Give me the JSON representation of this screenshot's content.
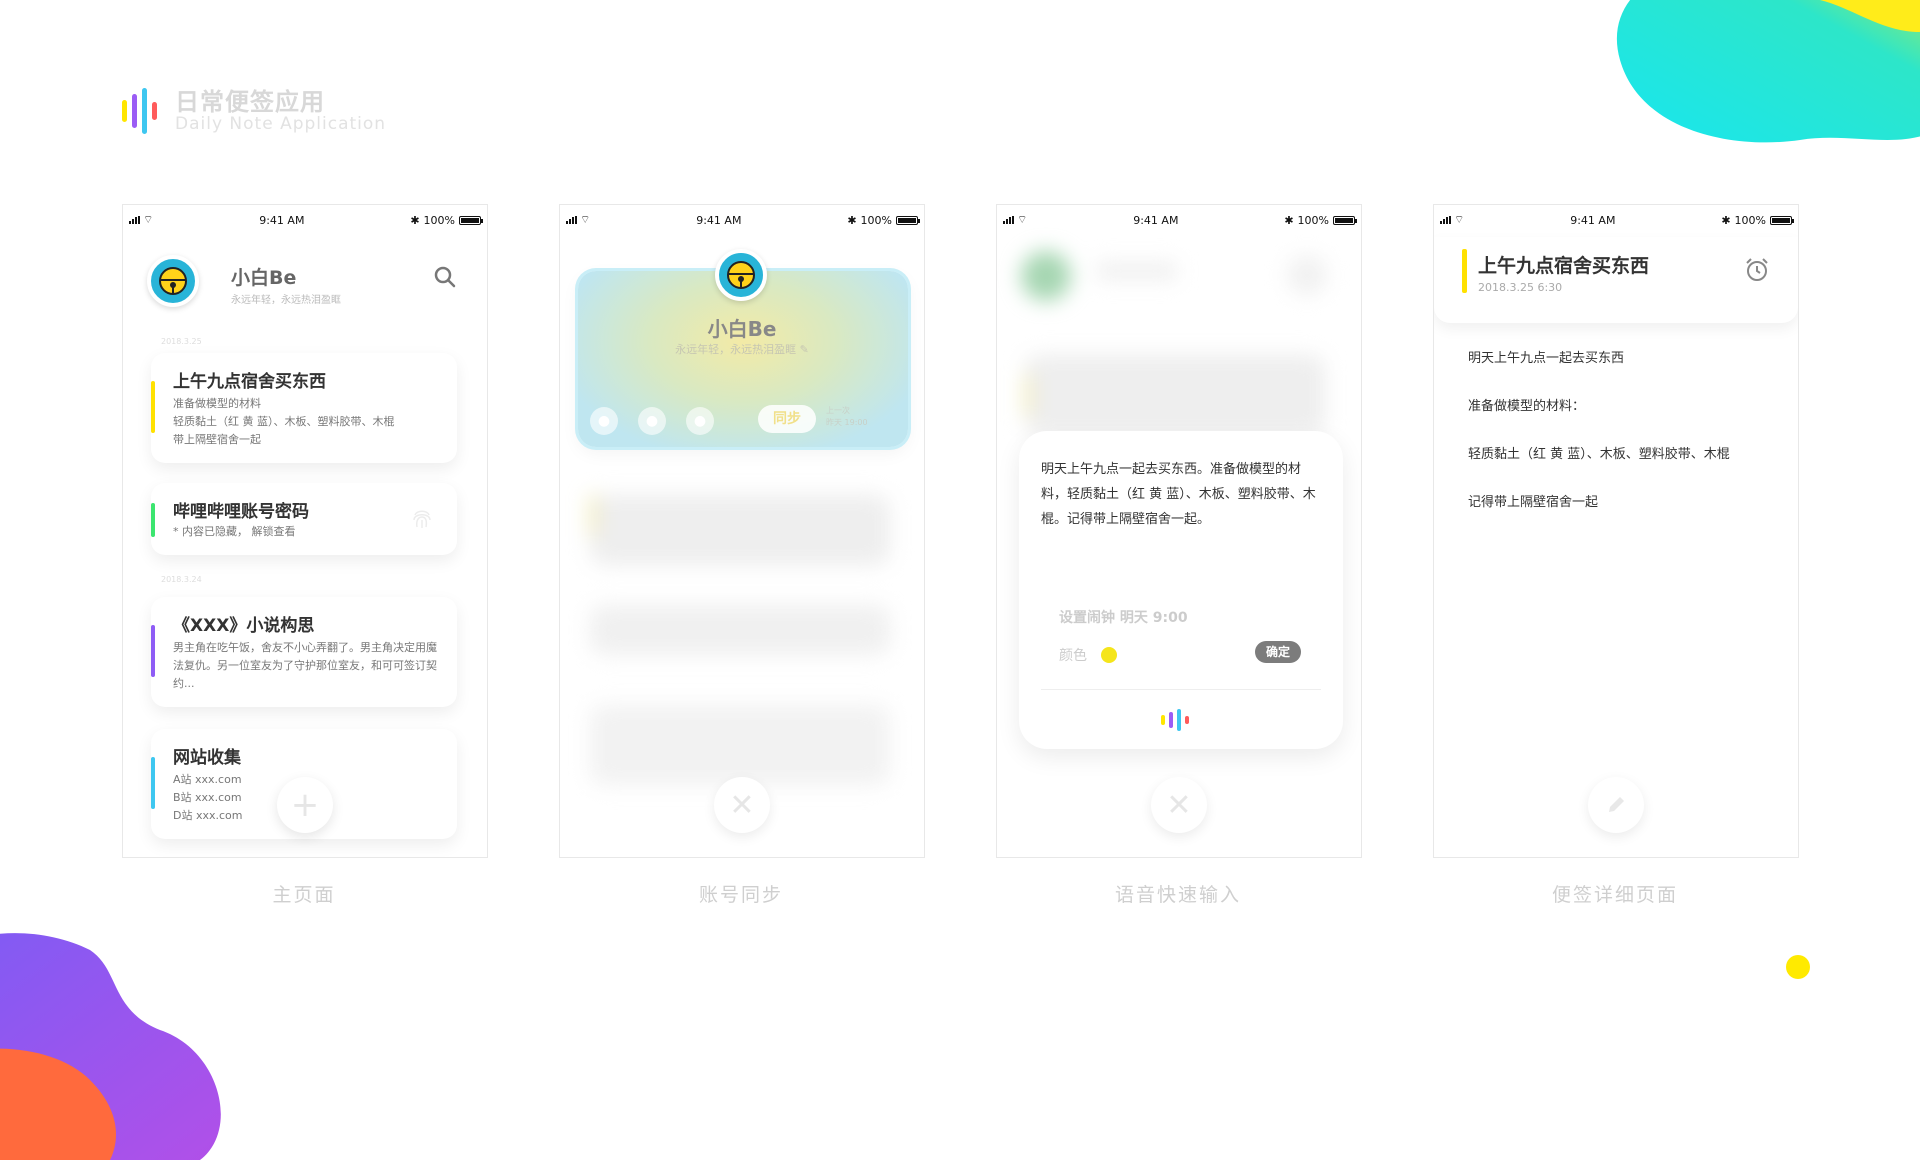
{
  "brand": {
    "title": "日常便签应用",
    "subtitle": "Daily Note Application",
    "bar_colors": [
      "#ffe600",
      "#9b5cf5",
      "#3ec7f0",
      "#ff5b5b"
    ]
  },
  "status_bar": {
    "time": "9:41 AM",
    "battery": "100%"
  },
  "user": {
    "name": "小白Be",
    "motto": "永远年轻，永远热泪盈眶"
  },
  "screens": {
    "home": {
      "caption": "主页面",
      "date1": "2018.3.25",
      "date2": "2018.3.24",
      "notes": [
        {
          "title": "上午九点宿舍买东西",
          "lines": [
            "准备做模型的材料",
            "轻质黏土（红 黄 蓝）、木板、塑料胶带、木棍",
            "带上隔壁宿舍一起"
          ],
          "color": "#ffe100"
        },
        {
          "title": "哔哩哔哩账号密码",
          "lines": [
            "* 内容已隐藏， 解锁查看"
          ],
          "color": "#3be56f"
        },
        {
          "title": "《XXX》小说构思",
          "lines": [
            "男主角在吃午饭，舍友不小心弄翻了。男主角决定用魔法复仇。另一位室友为了守护那位室友，和可可签订契约..."
          ],
          "color": "#8e5cf5"
        },
        {
          "title": "网站收集",
          "lines": [
            "A站 xxx.com",
            "B站 xxx.com",
            "D站 xxx.com"
          ],
          "color": "#3ec7f0"
        }
      ],
      "fab_symbol": "+"
    },
    "sync": {
      "caption": "账号同步",
      "sync_label": "同步",
      "last_sync_line1": "上一次",
      "last_sync_line2": "昨天 19:00",
      "close_symbol": "✕"
    },
    "voice": {
      "caption": "语音快速输入",
      "text": "明天上午九点一起去买东西。准备做模型的材料，轻质黏土（红 黄 蓝）、木板、塑料胶带、木棍。记得带上隔壁宿舍一起。",
      "alarm_label": "设置闹钟",
      "alarm_value": "明天 9:00",
      "color_label": "颜色",
      "color_value": "#f5e51b",
      "confirm_label": "确定",
      "close_symbol": "✕"
    },
    "detail": {
      "caption": "便签详细页面",
      "title": "上午九点宿舍买东西",
      "date": "2018.3.25 6:30",
      "paragraphs": [
        "明天上午九点一起去买东西",
        "准备做模型的材料：",
        "轻质黏土（红 黄 蓝）、木板、塑料胶带、木棍",
        "记得带上隔壁宿舍一起"
      ]
    }
  }
}
